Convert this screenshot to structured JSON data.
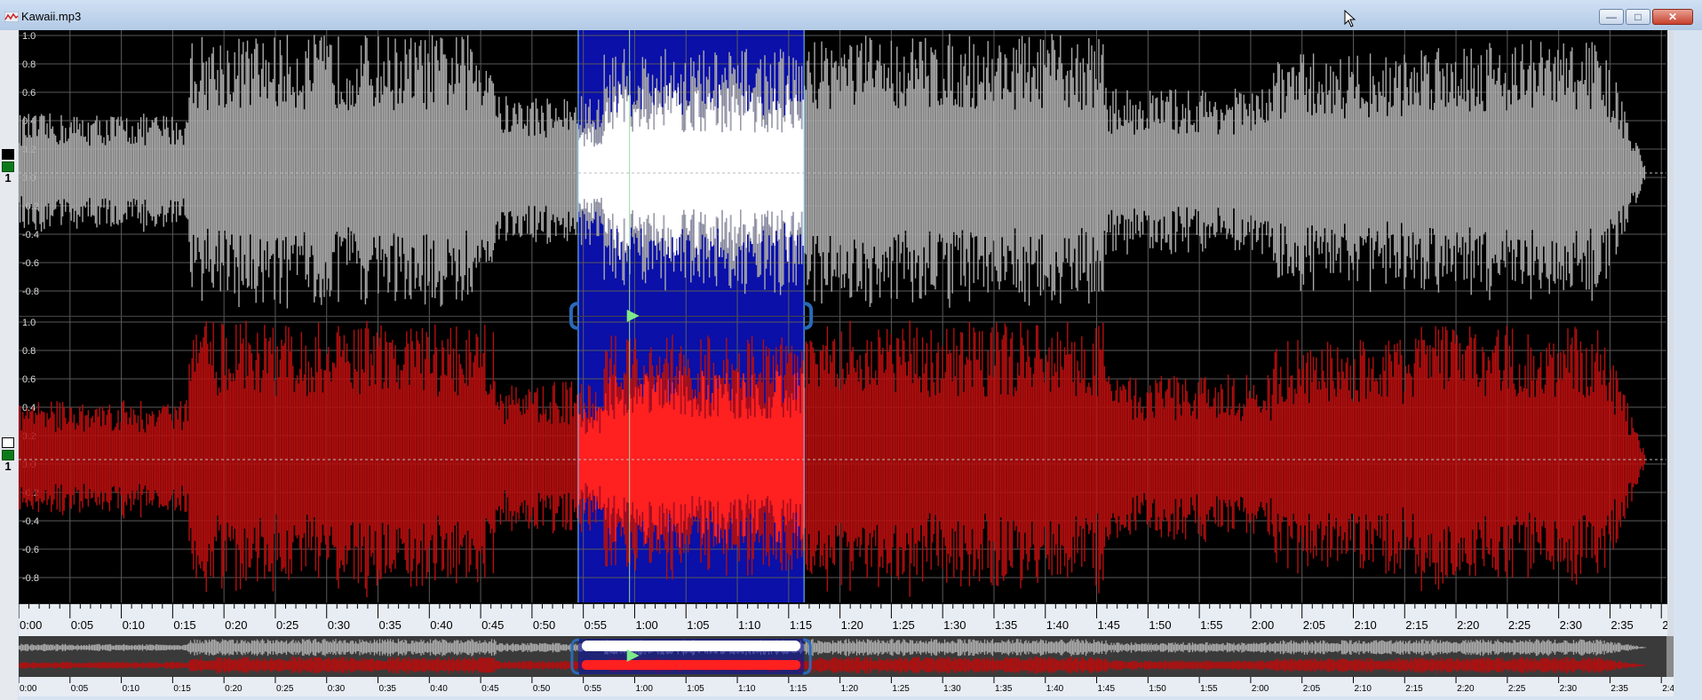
{
  "window": {
    "title": "Kawaii.mp3",
    "minimize_glyph": "—",
    "maximize_glyph": "□",
    "close_glyph": "✕"
  },
  "channels": [
    {
      "name": "1",
      "color": "#a9a9a9",
      "selected_color": "#ffffff"
    },
    {
      "name": "1",
      "color": "#b50e0e",
      "selected_color": "#ff2020"
    }
  ],
  "amplitude_ticks": [
    "1.0",
    "0.8",
    "0.6",
    "0.4",
    "0.2",
    "0.0",
    "-0.2",
    "-0.4",
    "-0.6",
    "-0.8"
  ],
  "time_ticks": [
    "0:00",
    "0:05",
    "0:10",
    "0:15",
    "0:20",
    "0:25",
    "0:30",
    "0:35",
    "0:40",
    "0:45",
    "0:50",
    "0:55",
    "1:00",
    "1:05",
    "1:10",
    "1:15",
    "1:20",
    "1:25",
    "1:30",
    "1:35",
    "1:40",
    "1:45",
    "1:50",
    "1:55",
    "2:00",
    "2:05",
    "2:10",
    "2:15",
    "2:20",
    "2:25",
    "2:30",
    "2:35",
    "2:4"
  ],
  "duration_seconds": 160.5,
  "selection": {
    "start_seconds": 54.5,
    "end_seconds": 76.5,
    "color": "#0a10a8"
  },
  "playhead_seconds": 59.5,
  "colors": {
    "background": "#000000",
    "grid": "#5a5a5a",
    "accent_play": "#7ee88a",
    "handle": "#2a6ab8"
  }
}
